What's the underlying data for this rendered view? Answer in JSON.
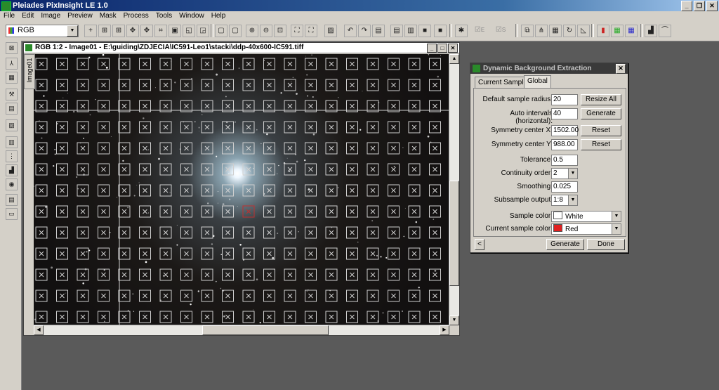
{
  "app": {
    "title": "Pleiades PixInsight LE 1.0",
    "ctrl_min": "_",
    "ctrl_restore": "❐",
    "ctrl_close": "✕"
  },
  "menu": [
    "File",
    "Edit",
    "Image",
    "Preview",
    "Mask",
    "Process",
    "Tools",
    "Window",
    "Help"
  ],
  "toolbar": {
    "color_mode": "RGB",
    "dropdown_arrow": "▼",
    "check_e": "E",
    "check_s": "S"
  },
  "image_window": {
    "title": "RGB 1:2 - Image01 - E:\\guiding\\ZDJECIA\\IC591-Leo1\\stacki\\ddp-40x600-IC591.tiff",
    "tab_label": "Image01",
    "ctrl_min": "_",
    "ctrl_max": "□",
    "ctrl_close": "✕",
    "scroll_up": "▲",
    "scroll_down": "▼",
    "scroll_left": "◀",
    "scroll_right": "▶"
  },
  "dbe": {
    "title": "Dynamic Background Extraction",
    "close": "✕",
    "tabs": [
      "Current Sample",
      "Global"
    ],
    "fields": {
      "default_sample_radius": {
        "label": "Default sample radius:",
        "value": "20"
      },
      "auto_intervals": {
        "label": "Auto intervals (horizontal):",
        "value": "40"
      },
      "symmetry_x": {
        "label": "Symmetry center X:",
        "value": "1502.00"
      },
      "symmetry_y": {
        "label": "Symmetry center Y:",
        "value": "988.00"
      },
      "tolerance": {
        "label": "Tolerance:",
        "value": "0.5"
      },
      "continuity_order": {
        "label": "Continuity order:",
        "value": "2"
      },
      "smoothing": {
        "label": "Smoothing:",
        "value": "0.025"
      },
      "subsample_output": {
        "label": "Subsample output:",
        "value": "1:8"
      },
      "sample_color": {
        "label": "Sample color:",
        "value": "White",
        "swatch": "#ffffff"
      },
      "current_sample_color": {
        "label": "Current sample color:",
        "value": "Red",
        "swatch": "#e02020"
      }
    },
    "buttons": {
      "resize_all": "Resize All",
      "generate_top": "Generate",
      "reset_x": "Reset",
      "reset_y": "Reset",
      "generate": "Generate",
      "done": "Done",
      "collapse": "<"
    }
  }
}
